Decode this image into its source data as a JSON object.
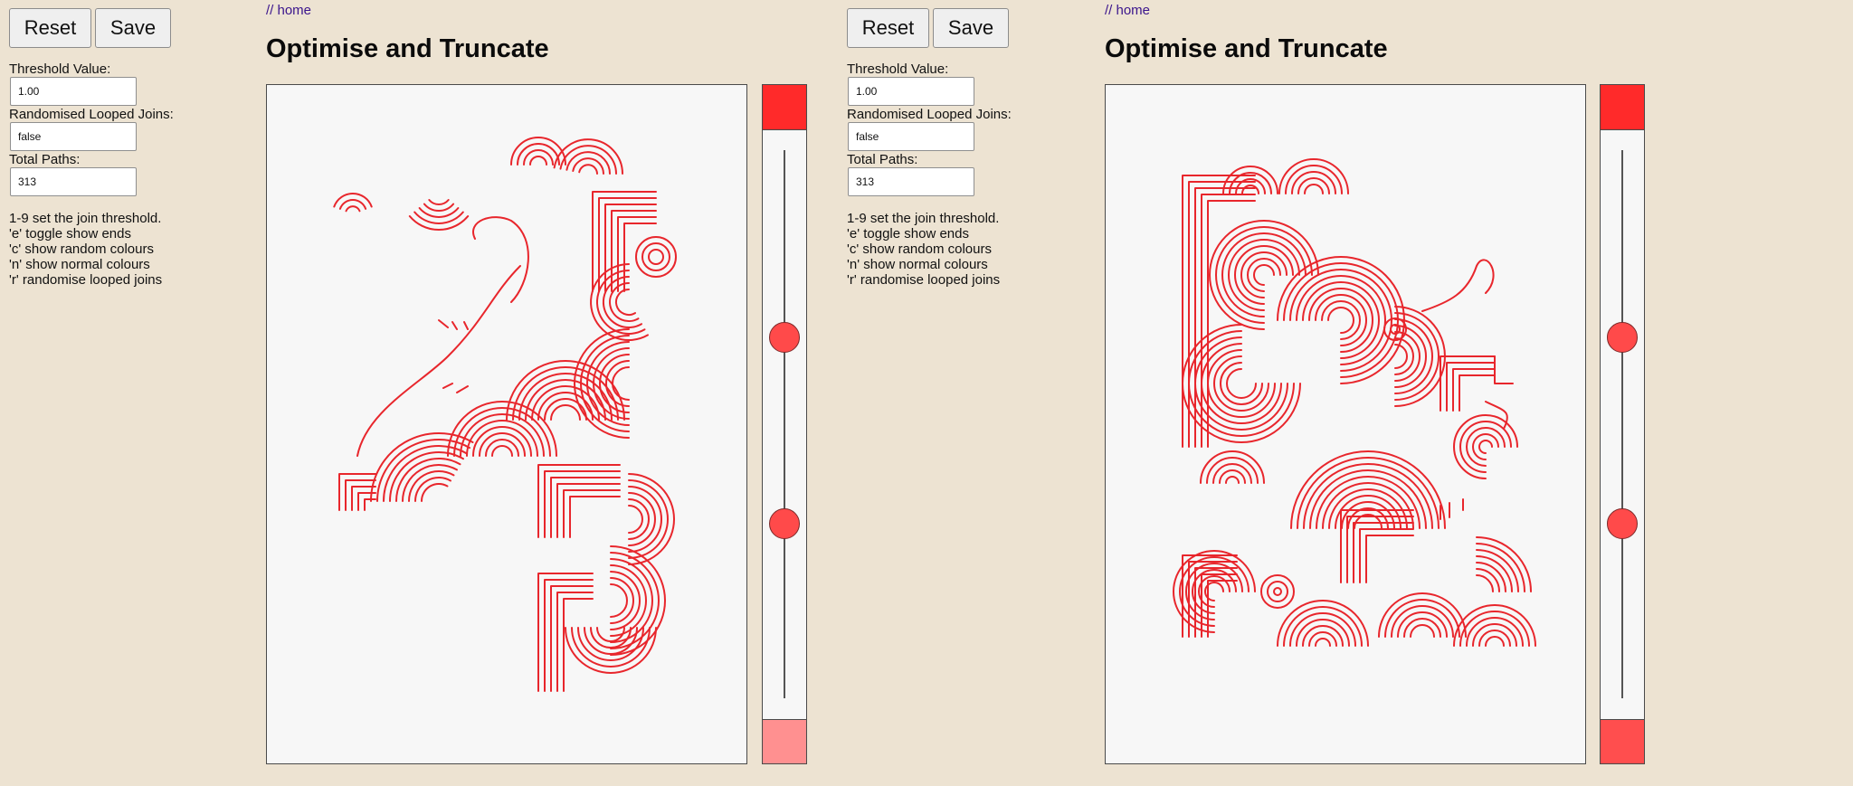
{
  "left": {
    "buttons": {
      "reset": "Reset",
      "save": "Save"
    },
    "controls": [
      {
        "label": "Threshold Value:",
        "value": "1.00"
      },
      {
        "label": "Randomised Looped Joins:",
        "value": "false"
      },
      {
        "label": "Total Paths:",
        "value": "313"
      }
    ],
    "help": [
      "1-9 set the join threshold.",
      "'e' toggle show ends",
      "'c' show random colours",
      "'n' show normal colours",
      "'r' randomise looped joins"
    ],
    "home_link": "// home",
    "title": "Optimise and Truncate",
    "scrollbar": {
      "knob_positions": [
        0.34,
        0.68
      ],
      "bottom_color": "#ff9090"
    }
  },
  "right": {
    "buttons": {
      "reset": "Reset",
      "save": "Save"
    },
    "controls": [
      {
        "label": "Threshold Value:",
        "value": "1.00"
      },
      {
        "label": "Randomised Looped Joins:",
        "value": "false"
      },
      {
        "label": "Total Paths:",
        "value": "313"
      }
    ],
    "help": [
      "1-9 set the join threshold.",
      "'e' toggle show ends",
      "'c' show random colours",
      "'n' show normal colours",
      "'r' randomise looped joins"
    ],
    "home_link": "// home",
    "title": "Optimise and Truncate",
    "scrollbar": {
      "knob_positions": [
        0.34,
        0.68
      ],
      "bottom_color": "#ff4e4e"
    }
  },
  "colors": {
    "background": "#ede3d2",
    "stroke": "#e8262c",
    "scroll_top": "#ff2a2a"
  }
}
